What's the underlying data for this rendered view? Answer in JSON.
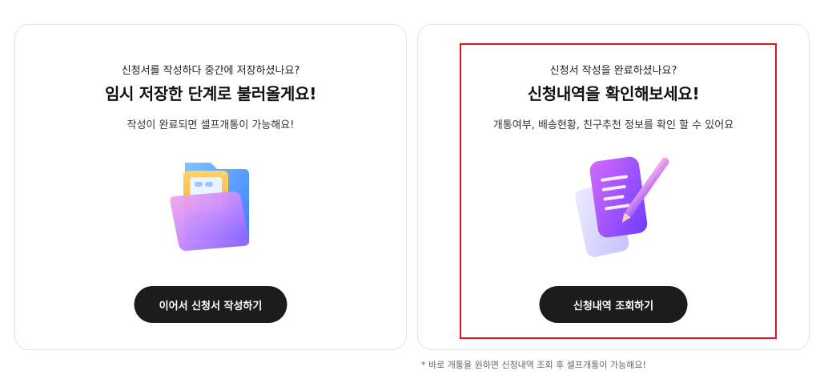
{
  "left_card": {
    "subtitle": "신청서를 작성하다 중간에 저장하셨나요?",
    "title": "임시 저장한 단계로 불러올게요!",
    "description": "작성이 완료되면 셀프개통이 가능해요!",
    "button_label": "이어서 신청서 작성하기",
    "icon": "folder-icon"
  },
  "right_card": {
    "subtitle": "신청서 작성을 완료하셨나요?",
    "title": "신청내역을 확인해보세요!",
    "description": "개통여부, 배송현황, 친구추천 정보를 확인 할 수 있어요",
    "button_label": "신청내역 조회하기",
    "icon": "document-pencil-icon"
  },
  "footnote": "* 바로 개통을 원하면 신청내역 조회 후 셀프개통이 가능해요!",
  "colors": {
    "button_bg": "#1c1c1c",
    "highlight_border": "#e8141b",
    "card_border": "#e3e3e3"
  }
}
